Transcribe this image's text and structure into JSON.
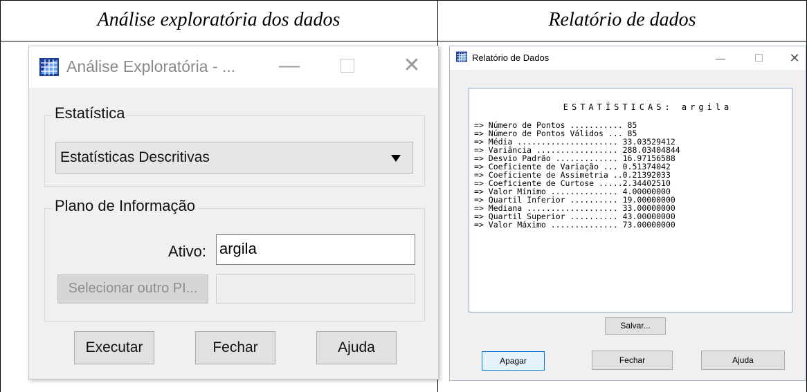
{
  "captions": {
    "left": "Análise exploratória dos dados",
    "right": "Relatório de dados"
  },
  "left_dialog": {
    "title": "Análise Exploratória - ...",
    "minimize": "—",
    "close": "✕",
    "estatistica_group": "Estatística",
    "estatistica_selected": "Estatísticas Descritivas",
    "plano_group": "Plano de Informação",
    "ativo_label": "Ativo:",
    "ativo_value": "argila",
    "select_other_label": "Selecionar outro PI...",
    "select_other_value": "",
    "buttons": {
      "executar": "Executar",
      "fechar": "Fechar",
      "ajuda": "Ajuda"
    }
  },
  "right_dialog": {
    "title": "Relatório de Dados",
    "minimize": "—",
    "close": "✕",
    "report_heading": "ESTATÍSTICAS: argila",
    "report_lines": [
      "=> Número de Pontos ........... 85",
      "=> Número de Pontos Válidos ... 85",
      "=> Média ..................... 33.03529412",
      "=> Variância ................. 288.03404844",
      "=> Desvio Padrão ............. 16.97156588",
      "=> Coeficiente de Variação ... 0.51374042",
      "=> Coeficiente de Assimetria ..0.21392033",
      "=> Coeficiente de Curtose .....2.34402510",
      "=> Valor Mínimo .............. 4.00000000",
      "=> Quartil Inferior .......... 19.00000000",
      "=> Mediana ................... 33.00000000",
      "=> Quartil Superior .......... 43.00000000",
      "=> Valor Máximo .............. 73.00000000"
    ],
    "buttons": {
      "salvar": "Salvar...",
      "apagar": "Apagar",
      "fechar": "Fechar",
      "ajuda": "Ajuda"
    }
  }
}
